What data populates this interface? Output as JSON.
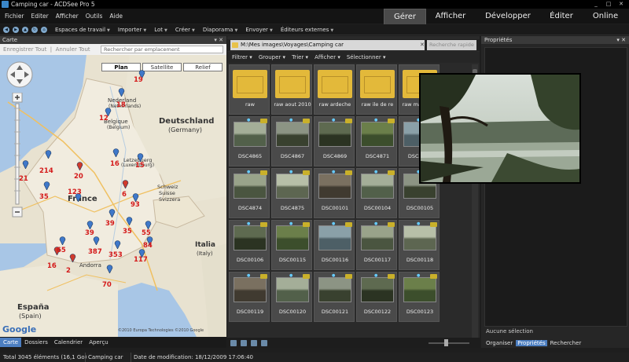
{
  "window": {
    "title": "Camping car - ACDSee Pro 5"
  },
  "menu": [
    "Fichier",
    "Editer",
    "Afficher",
    "Outils",
    "Aide"
  ],
  "modes": [
    "Gérer",
    "Afficher",
    "Développer",
    "Éditer",
    "Online"
  ],
  "toolbar": {
    "menus": [
      "Espaces de travail",
      "Importer",
      "Lot",
      "Créer",
      "Diaporama",
      "Envoyer",
      "Éditeurs externes"
    ]
  },
  "map_panel": {
    "title": "Carte",
    "save_link": "Enregistrer Tout",
    "cancel_link": "Annuler Tout",
    "search_placeholder": "Rechercher par emplacement",
    "map_types": [
      "Plan",
      "Satellite",
      "Relief"
    ],
    "attribution": "Google",
    "copyright": "©2010 Europa Technologies ©2010 Google",
    "places": [
      {
        "label": "Nederland"
      },
      {
        "label": "(Netherlands)"
      },
      {
        "label": "Belgique"
      },
      {
        "label": "(Belgium)"
      },
      {
        "label": "Deutschland"
      },
      {
        "label": "(Germany)"
      },
      {
        "label": "Letzebuerg"
      },
      {
        "label": "(Luxembourg)"
      },
      {
        "label": "France"
      },
      {
        "label": "Schweiz"
      },
      {
        "label": "Suisse"
      },
      {
        "label": "Svizzera"
      },
      {
        "label": "Italia"
      },
      {
        "label": "(Italy)"
      },
      {
        "label": "Andorra"
      },
      {
        "label": "España"
      },
      {
        "label": "(Spain)"
      }
    ],
    "clusters": [
      "19",
      "18",
      "12",
      "214",
      "21",
      "20",
      "16",
      "15",
      "35",
      "123",
      "6",
      "93",
      "39",
      "35",
      "39",
      "55",
      "387",
      "353",
      "84",
      "117",
      "70",
      "16",
      "2",
      "65"
    ]
  },
  "map_tabs": [
    "Carte",
    "Dossiers",
    "Calendrier",
    "Aperçu"
  ],
  "browser": {
    "path": "M:\\Mes images\\Voyages\\Camping car",
    "search_placeholder": "Recherche rapide",
    "filters": [
      "Filtrer",
      "Grouper",
      "Trier",
      "Afficher",
      "Sélectionner"
    ],
    "items": [
      {
        "name": "raw",
        "kind": "folder"
      },
      {
        "name": "raw aout 2010",
        "kind": "folder"
      },
      {
        "name": "raw ardeche",
        "kind": "folder"
      },
      {
        "name": "raw ile de re",
        "kind": "folder"
      },
      {
        "name": "raw mai 2010",
        "kind": "folder"
      },
      {
        "name": "DSC4865",
        "kind": "photo"
      },
      {
        "name": "DSC4867",
        "kind": "photo"
      },
      {
        "name": "DSC4869",
        "kind": "photo"
      },
      {
        "name": "DSC4871",
        "kind": "photo"
      },
      {
        "name": "DSC4873",
        "kind": "photo"
      },
      {
        "name": "DSC4874",
        "kind": "photo"
      },
      {
        "name": "DSC4875",
        "kind": "photo"
      },
      {
        "name": "DSC00101",
        "kind": "photo"
      },
      {
        "name": "DSC00104",
        "kind": "photo"
      },
      {
        "name": "DSC00105",
        "kind": "photo"
      },
      {
        "name": "DSC00106",
        "kind": "photo"
      },
      {
        "name": "DSC00115",
        "kind": "photo"
      },
      {
        "name": "DSC00116",
        "kind": "photo"
      },
      {
        "name": "DSC00117",
        "kind": "photo"
      },
      {
        "name": "DSC00118",
        "kind": "photo"
      },
      {
        "name": "DSC00119",
        "kind": "photo"
      },
      {
        "name": "DSC00120",
        "kind": "photo"
      },
      {
        "name": "DSC00121",
        "kind": "photo"
      },
      {
        "name": "DSC00122",
        "kind": "photo"
      },
      {
        "name": "DSC00123",
        "kind": "photo"
      }
    ]
  },
  "properties": {
    "title": "Propriétés",
    "no_selection": "Aucune sélection",
    "tabs": [
      "Organiser",
      "Propriétés",
      "Rechercher"
    ]
  },
  "status": {
    "total": "Total 3045 éléments (16,1 Go)",
    "folder": "Camping car",
    "modified": "Date de modification: 18/12/2009 17:06:40"
  }
}
